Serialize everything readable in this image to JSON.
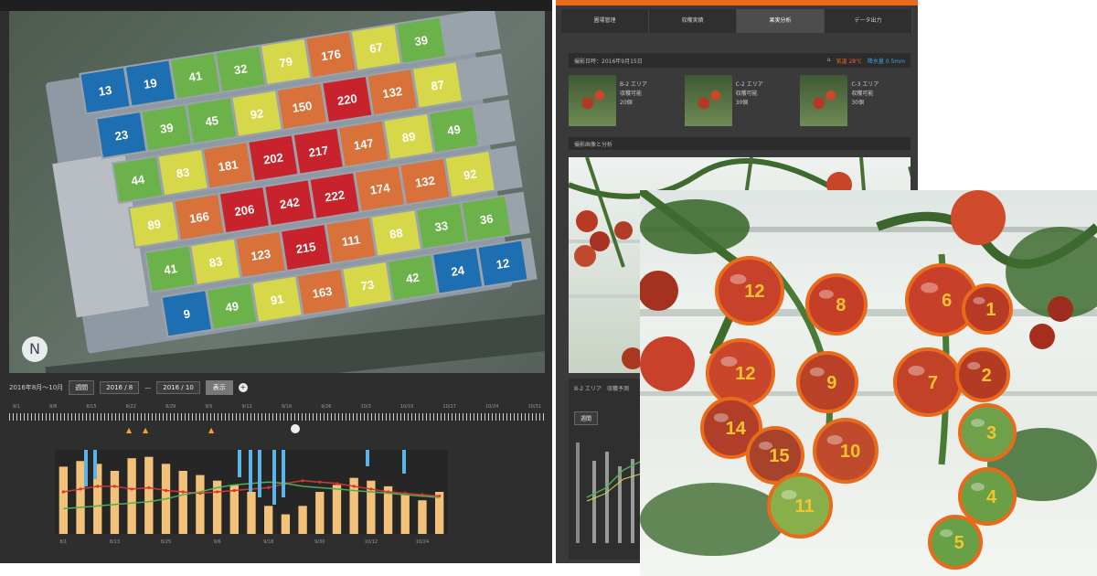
{
  "colors": {
    "blue": "#1e6fb2",
    "lime": "#8dc04a",
    "green": "#6bb24a",
    "yellow": "#d6d84a",
    "orange": "#d9713a",
    "red": "#c8232c",
    "accent_orange": "#e86a1a"
  },
  "grid": [
    [
      {
        "v": "13",
        "c": "blue"
      },
      {
        "v": "19",
        "c": "blue"
      },
      {
        "v": "41",
        "c": "green"
      },
      {
        "v": "32",
        "c": "green"
      },
      {
        "v": "79",
        "c": "yellow"
      },
      {
        "v": "176",
        "c": "orange"
      },
      {
        "v": "67",
        "c": "yellow"
      },
      {
        "v": "39",
        "c": "green"
      }
    ],
    [
      {
        "v": "23",
        "c": "blue"
      },
      {
        "v": "39",
        "c": "green"
      },
      {
        "v": "45",
        "c": "green"
      },
      {
        "v": "92",
        "c": "yellow"
      },
      {
        "v": "150",
        "c": "orange"
      },
      {
        "v": "220",
        "c": "red"
      },
      {
        "v": "132",
        "c": "orange"
      },
      {
        "v": "87",
        "c": "yellow"
      }
    ],
    [
      {
        "v": "44",
        "c": "green"
      },
      {
        "v": "83",
        "c": "yellow"
      },
      {
        "v": "181",
        "c": "orange"
      },
      {
        "v": "202",
        "c": "red"
      },
      {
        "v": "217",
        "c": "red"
      },
      {
        "v": "147",
        "c": "orange"
      },
      {
        "v": "89",
        "c": "yellow"
      },
      {
        "v": "49",
        "c": "green"
      }
    ],
    [
      {
        "v": "89",
        "c": "yellow"
      },
      {
        "v": "166",
        "c": "orange"
      },
      {
        "v": "206",
        "c": "red"
      },
      {
        "v": "242",
        "c": "red"
      },
      {
        "v": "222",
        "c": "red"
      },
      {
        "v": "174",
        "c": "orange"
      },
      {
        "v": "132",
        "c": "orange"
      },
      {
        "v": "92",
        "c": "yellow"
      }
    ],
    [
      {
        "v": "41",
        "c": "green"
      },
      {
        "v": "83",
        "c": "yellow"
      },
      {
        "v": "123",
        "c": "orange"
      },
      {
        "v": "215",
        "c": "red"
      },
      {
        "v": "111",
        "c": "orange"
      },
      {
        "v": "88",
        "c": "yellow"
      },
      {
        "v": "33",
        "c": "green"
      },
      {
        "v": "36",
        "c": "green"
      }
    ],
    [
      {
        "v": "9",
        "c": "blue"
      },
      {
        "v": "49",
        "c": "green"
      },
      {
        "v": "91",
        "c": "yellow"
      },
      {
        "v": "163",
        "c": "orange"
      },
      {
        "v": "73",
        "c": "yellow"
      },
      {
        "v": "42",
        "c": "green"
      },
      {
        "v": "24",
        "c": "blue"
      },
      {
        "v": "12",
        "c": "blue"
      }
    ]
  ],
  "controls": {
    "range_label": "2016年8月〜10月",
    "select_mode": "週間",
    "date_from": "2016 / 8",
    "date_to": "2016 / 10",
    "button": "表示",
    "plus": "+"
  },
  "compass": "N",
  "timeline": {
    "labels": [
      "8/1",
      "8/8",
      "8/15",
      "8/22",
      "8/29",
      "9/5",
      "9/12",
      "9/19",
      "9/26",
      "10/3",
      "10/10",
      "10/17",
      "10/24",
      "10/31"
    ]
  },
  "tabs": [
    "圃場管理",
    "収穫実績",
    "果実分析",
    "データ出力"
  ],
  "info_bar": {
    "left": "撮影日時：2016年9月15日",
    "temp": "気温 28℃",
    "rain": "降水量 0.5mm"
  },
  "thumbs": [
    {
      "line1": "B-2 エリア",
      "line2": "収穫可能",
      "line3": "20個"
    },
    {
      "line1": "C-2 エリア",
      "line2": "収穫可能",
      "line3": "30個"
    },
    {
      "line1": "C-3 エリア",
      "line2": "収穫可能",
      "line3": "30個"
    }
  ],
  "section_title": "撮影画像と分析",
  "mid_bottom": {
    "header": "B-2 エリア　収穫予測",
    "select": "週間"
  },
  "tomatoes": [
    {
      "label": "12"
    },
    {
      "label": "8"
    },
    {
      "label": "6"
    },
    {
      "label": "1"
    },
    {
      "label": "12"
    },
    {
      "label": "9"
    },
    {
      "label": "7"
    },
    {
      "label": "2"
    },
    {
      "label": "14"
    },
    {
      "label": "15"
    },
    {
      "label": "10"
    },
    {
      "label": "3"
    },
    {
      "label": "11"
    },
    {
      "label": "4"
    },
    {
      "label": "5"
    }
  ],
  "chart_data": {
    "type": "bar",
    "x": [
      "8/1",
      "8/5",
      "8/9",
      "8/13",
      "8/17",
      "8/21",
      "8/25",
      "8/29",
      "9/2",
      "9/6",
      "9/10",
      "9/14",
      "9/18",
      "9/22",
      "9/26",
      "9/30",
      "10/4",
      "10/8",
      "10/12",
      "10/16",
      "10/20",
      "10/24",
      "10/28"
    ],
    "series": [
      {
        "values": [
          48,
          52,
          50,
          45,
          54,
          55,
          50,
          45,
          42,
          38,
          35,
          30,
          20,
          14,
          20,
          30,
          35,
          40,
          38,
          34,
          28,
          24,
          30
        ]
      },
      {
        "values": [
          30,
          32,
          34,
          34,
          32,
          33,
          31,
          30,
          29,
          30,
          31,
          32,
          33,
          36,
          38,
          37,
          36,
          34,
          32,
          30,
          29,
          28,
          27
        ]
      },
      {
        "values": [
          18,
          19,
          20,
          21,
          22,
          23,
          25,
          28,
          30,
          33,
          35,
          36,
          37,
          36,
          34,
          33,
          32,
          31,
          30,
          29,
          28,
          27,
          26
        ]
      }
    ]
  }
}
